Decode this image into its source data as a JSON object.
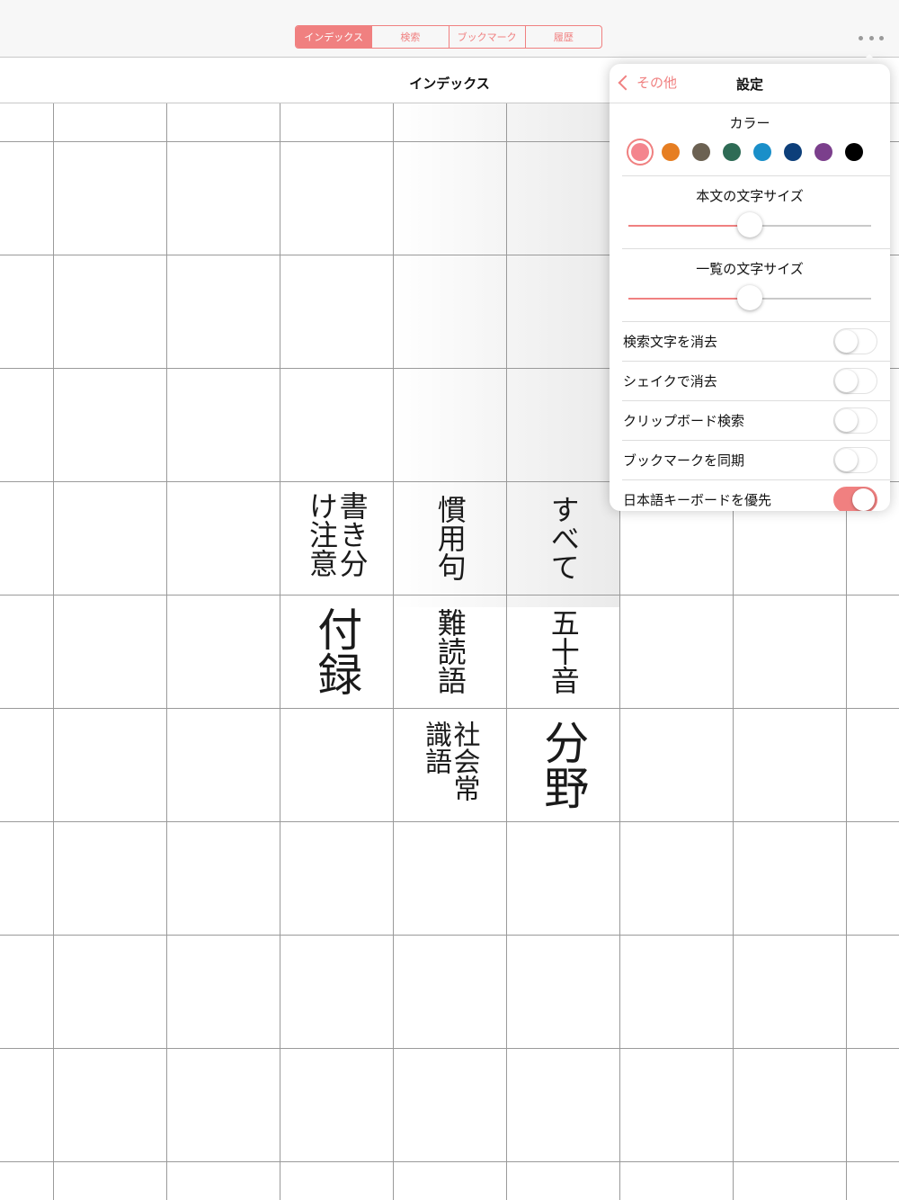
{
  "toolbar": {
    "tabs": [
      "インデックス",
      "検索",
      "ブックマーク",
      "履歴"
    ],
    "active_tab": 0,
    "more_icon": "ellipsis-icon"
  },
  "nav": {
    "title": "インデックス"
  },
  "grid": {
    "cells": [
      {
        "name": "cell-kakiwake",
        "text": "書き分け注意",
        "style": "s"
      },
      {
        "name": "cell-kanyouku",
        "text": "慣用句",
        "style": "s"
      },
      {
        "name": "cell-subete",
        "text": "すべて",
        "style": "s"
      },
      {
        "name": "cell-furoku",
        "text": "付録",
        "style": "l"
      },
      {
        "name": "cell-nandokugo",
        "text": "難読語",
        "style": "s"
      },
      {
        "name": "cell-gojuon",
        "text": "五十音",
        "style": "s"
      },
      {
        "name": "cell-shakaijoshiki",
        "text": "社会常識語",
        "style": "m"
      },
      {
        "name": "cell-bunya",
        "text": "分野",
        "style": "l"
      }
    ]
  },
  "settings": {
    "back_label": "その他",
    "title": "設定",
    "color_label": "カラー",
    "colors": [
      "#f4858e",
      "#e67e22",
      "#6b6152",
      "#2e6b55",
      "#1a8fc9",
      "#0d3f7a",
      "#7b3f8c",
      "#000000"
    ],
    "selected_color": 0,
    "body_size_label": "本文の文字サイズ",
    "body_size_value": 0.5,
    "list_size_label": "一覧の文字サイズ",
    "list_size_value": 0.5,
    "toggles": [
      {
        "label": "検索文字を消去",
        "on": false
      },
      {
        "label": "シェイクで消去",
        "on": false
      },
      {
        "label": "クリップボード検索",
        "on": false
      },
      {
        "label": "ブックマークを同期",
        "on": false
      },
      {
        "label": "日本語キーボードを優先",
        "on": true
      }
    ]
  }
}
